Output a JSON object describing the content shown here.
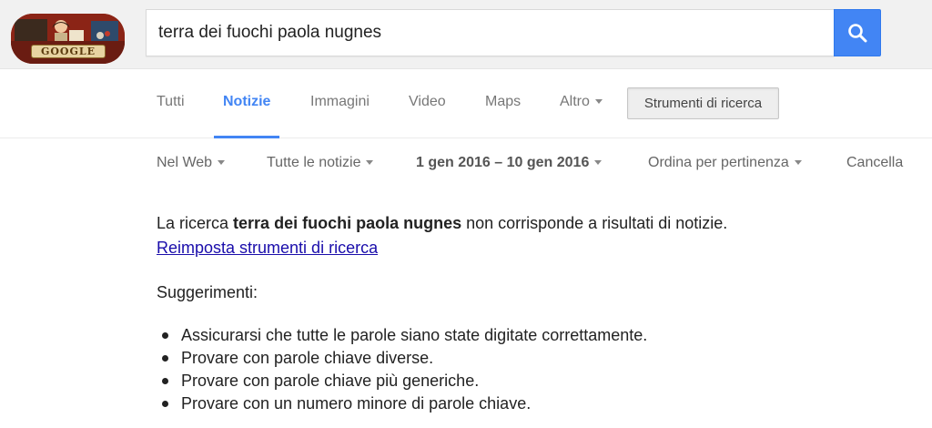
{
  "logo": {
    "text": "GOOGLE"
  },
  "search": {
    "query": "terra dei fuochi paola nugnes"
  },
  "tabs": [
    {
      "label": "Tutti"
    },
    {
      "label": "Notizie"
    },
    {
      "label": "Immagini"
    },
    {
      "label": "Video"
    },
    {
      "label": "Maps"
    },
    {
      "label": "Altro"
    }
  ],
  "tools_button": {
    "label": "Strumenti di ricerca"
  },
  "tools": {
    "web": "Nel Web",
    "news": "Tutte le notizie",
    "date_range": "1 gen 2016 – 10 gen 2016",
    "sort": "Ordina per pertinenza",
    "cancel": "Cancella"
  },
  "result": {
    "prefix": "La ricerca ",
    "query": "terra dei fuochi paola nugnes",
    "suffix": " non corrisponde a risultati di notizie. ",
    "reset_link": "Reimposta strumenti di ricerca"
  },
  "suggestions": {
    "title": "Suggerimenti:",
    "items": [
      "Assicurarsi che tutte le parole siano state digitate correttamente.",
      "Provare con parole chiave diverse.",
      "Provare con parole chiave più generiche.",
      "Provare con un numero minore di parole chiave."
    ]
  },
  "colors": {
    "accent": "#4285f4",
    "link": "#1a0dab",
    "header_bg": "#f1f1f1"
  }
}
